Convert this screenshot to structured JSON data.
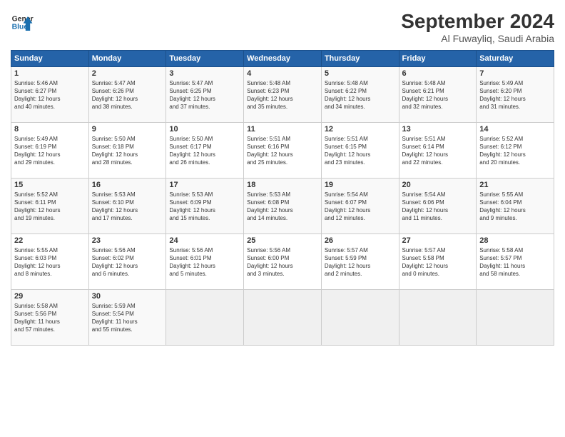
{
  "header": {
    "logo_line1": "General",
    "logo_line2": "Blue",
    "month": "September 2024",
    "location": "Al Fuwayliq, Saudi Arabia"
  },
  "weekdays": [
    "Sunday",
    "Monday",
    "Tuesday",
    "Wednesday",
    "Thursday",
    "Friday",
    "Saturday"
  ],
  "weeks": [
    [
      {
        "day": "1",
        "lines": [
          "Sunrise: 5:46 AM",
          "Sunset: 6:27 PM",
          "Daylight: 12 hours",
          "and 40 minutes."
        ]
      },
      {
        "day": "2",
        "lines": [
          "Sunrise: 5:47 AM",
          "Sunset: 6:26 PM",
          "Daylight: 12 hours",
          "and 38 minutes."
        ]
      },
      {
        "day": "3",
        "lines": [
          "Sunrise: 5:47 AM",
          "Sunset: 6:25 PM",
          "Daylight: 12 hours",
          "and 37 minutes."
        ]
      },
      {
        "day": "4",
        "lines": [
          "Sunrise: 5:48 AM",
          "Sunset: 6:23 PM",
          "Daylight: 12 hours",
          "and 35 minutes."
        ]
      },
      {
        "day": "5",
        "lines": [
          "Sunrise: 5:48 AM",
          "Sunset: 6:22 PM",
          "Daylight: 12 hours",
          "and 34 minutes."
        ]
      },
      {
        "day": "6",
        "lines": [
          "Sunrise: 5:48 AM",
          "Sunset: 6:21 PM",
          "Daylight: 12 hours",
          "and 32 minutes."
        ]
      },
      {
        "day": "7",
        "lines": [
          "Sunrise: 5:49 AM",
          "Sunset: 6:20 PM",
          "Daylight: 12 hours",
          "and 31 minutes."
        ]
      }
    ],
    [
      {
        "day": "8",
        "lines": [
          "Sunrise: 5:49 AM",
          "Sunset: 6:19 PM",
          "Daylight: 12 hours",
          "and 29 minutes."
        ]
      },
      {
        "day": "9",
        "lines": [
          "Sunrise: 5:50 AM",
          "Sunset: 6:18 PM",
          "Daylight: 12 hours",
          "and 28 minutes."
        ]
      },
      {
        "day": "10",
        "lines": [
          "Sunrise: 5:50 AM",
          "Sunset: 6:17 PM",
          "Daylight: 12 hours",
          "and 26 minutes."
        ]
      },
      {
        "day": "11",
        "lines": [
          "Sunrise: 5:51 AM",
          "Sunset: 6:16 PM",
          "Daylight: 12 hours",
          "and 25 minutes."
        ]
      },
      {
        "day": "12",
        "lines": [
          "Sunrise: 5:51 AM",
          "Sunset: 6:15 PM",
          "Daylight: 12 hours",
          "and 23 minutes."
        ]
      },
      {
        "day": "13",
        "lines": [
          "Sunrise: 5:51 AM",
          "Sunset: 6:14 PM",
          "Daylight: 12 hours",
          "and 22 minutes."
        ]
      },
      {
        "day": "14",
        "lines": [
          "Sunrise: 5:52 AM",
          "Sunset: 6:12 PM",
          "Daylight: 12 hours",
          "and 20 minutes."
        ]
      }
    ],
    [
      {
        "day": "15",
        "lines": [
          "Sunrise: 5:52 AM",
          "Sunset: 6:11 PM",
          "Daylight: 12 hours",
          "and 19 minutes."
        ]
      },
      {
        "day": "16",
        "lines": [
          "Sunrise: 5:53 AM",
          "Sunset: 6:10 PM",
          "Daylight: 12 hours",
          "and 17 minutes."
        ]
      },
      {
        "day": "17",
        "lines": [
          "Sunrise: 5:53 AM",
          "Sunset: 6:09 PM",
          "Daylight: 12 hours",
          "and 15 minutes."
        ]
      },
      {
        "day": "18",
        "lines": [
          "Sunrise: 5:53 AM",
          "Sunset: 6:08 PM",
          "Daylight: 12 hours",
          "and 14 minutes."
        ]
      },
      {
        "day": "19",
        "lines": [
          "Sunrise: 5:54 AM",
          "Sunset: 6:07 PM",
          "Daylight: 12 hours",
          "and 12 minutes."
        ]
      },
      {
        "day": "20",
        "lines": [
          "Sunrise: 5:54 AM",
          "Sunset: 6:06 PM",
          "Daylight: 12 hours",
          "and 11 minutes."
        ]
      },
      {
        "day": "21",
        "lines": [
          "Sunrise: 5:55 AM",
          "Sunset: 6:04 PM",
          "Daylight: 12 hours",
          "and 9 minutes."
        ]
      }
    ],
    [
      {
        "day": "22",
        "lines": [
          "Sunrise: 5:55 AM",
          "Sunset: 6:03 PM",
          "Daylight: 12 hours",
          "and 8 minutes."
        ]
      },
      {
        "day": "23",
        "lines": [
          "Sunrise: 5:56 AM",
          "Sunset: 6:02 PM",
          "Daylight: 12 hours",
          "and 6 minutes."
        ]
      },
      {
        "day": "24",
        "lines": [
          "Sunrise: 5:56 AM",
          "Sunset: 6:01 PM",
          "Daylight: 12 hours",
          "and 5 minutes."
        ]
      },
      {
        "day": "25",
        "lines": [
          "Sunrise: 5:56 AM",
          "Sunset: 6:00 PM",
          "Daylight: 12 hours",
          "and 3 minutes."
        ]
      },
      {
        "day": "26",
        "lines": [
          "Sunrise: 5:57 AM",
          "Sunset: 5:59 PM",
          "Daylight: 12 hours",
          "and 2 minutes."
        ]
      },
      {
        "day": "27",
        "lines": [
          "Sunrise: 5:57 AM",
          "Sunset: 5:58 PM",
          "Daylight: 12 hours",
          "and 0 minutes."
        ]
      },
      {
        "day": "28",
        "lines": [
          "Sunrise: 5:58 AM",
          "Sunset: 5:57 PM",
          "Daylight: 11 hours",
          "and 58 minutes."
        ]
      }
    ],
    [
      {
        "day": "29",
        "lines": [
          "Sunrise: 5:58 AM",
          "Sunset: 5:56 PM",
          "Daylight: 11 hours",
          "and 57 minutes."
        ]
      },
      {
        "day": "30",
        "lines": [
          "Sunrise: 5:59 AM",
          "Sunset: 5:54 PM",
          "Daylight: 11 hours",
          "and 55 minutes."
        ]
      },
      {
        "day": "",
        "lines": []
      },
      {
        "day": "",
        "lines": []
      },
      {
        "day": "",
        "lines": []
      },
      {
        "day": "",
        "lines": []
      },
      {
        "day": "",
        "lines": []
      }
    ]
  ]
}
